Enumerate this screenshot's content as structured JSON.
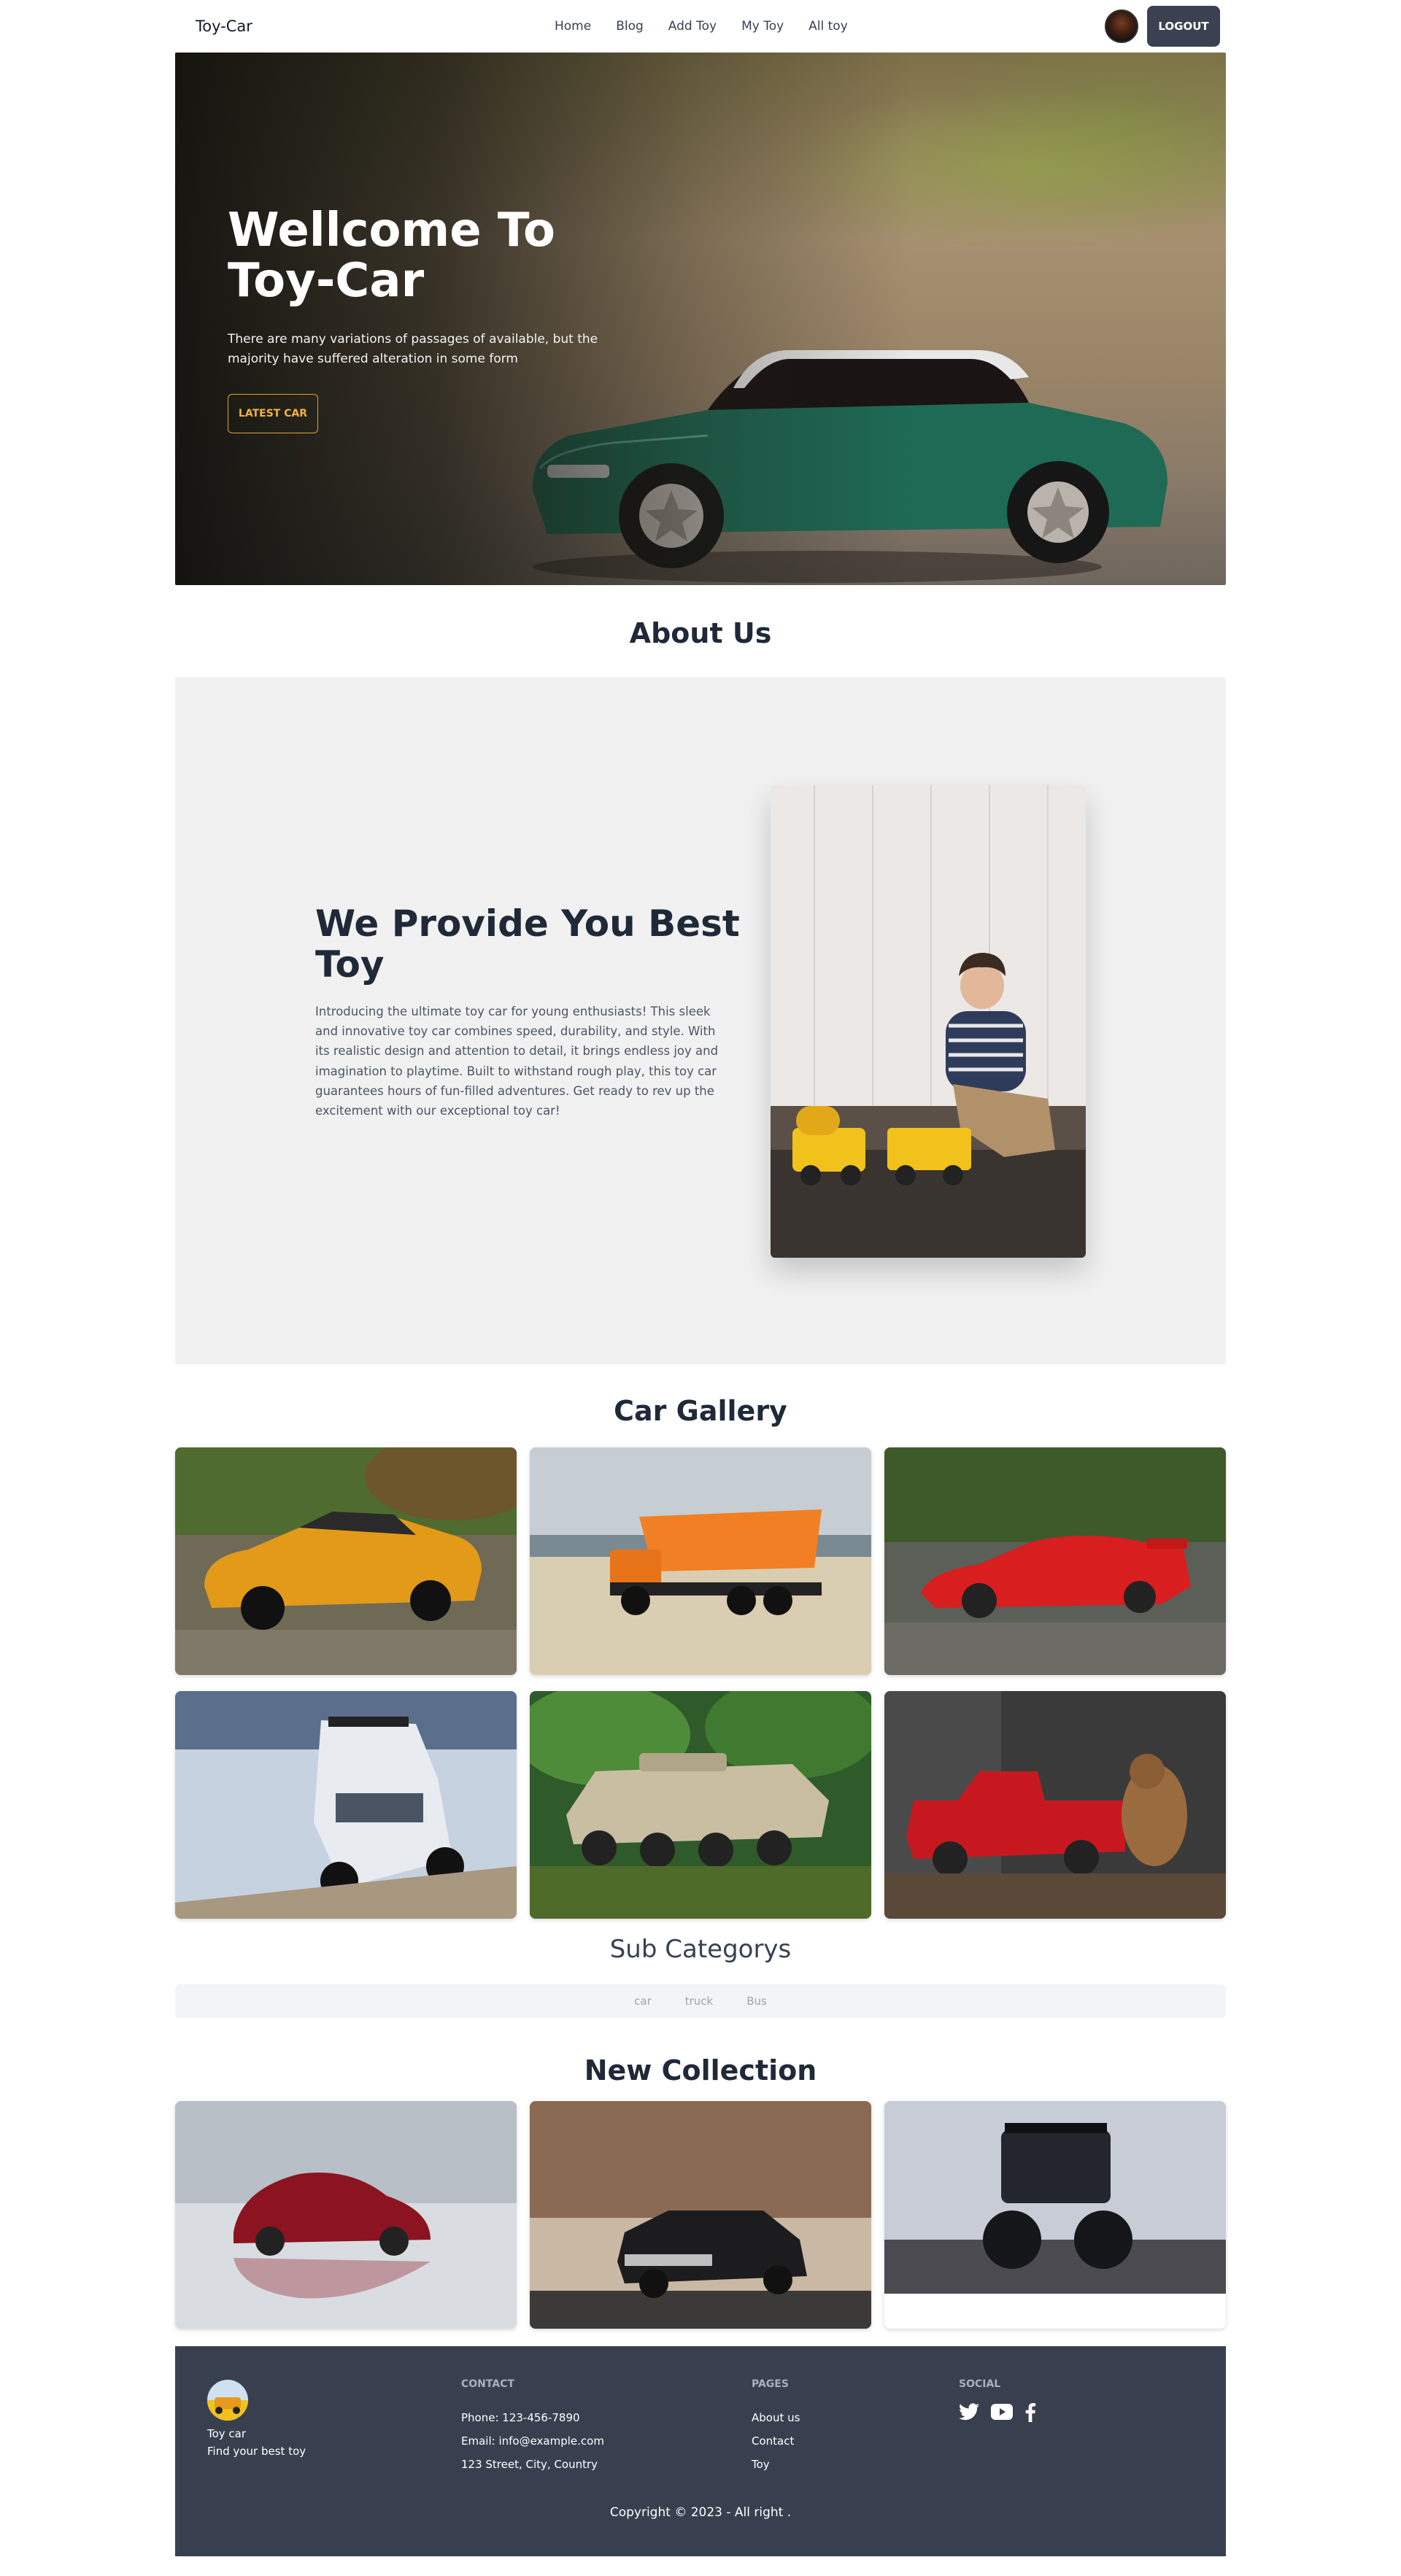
{
  "nav": {
    "brand": "Toy-Car",
    "links": [
      "Home",
      "Blog",
      "Add Toy",
      "My Toy",
      "All toy"
    ],
    "logout": "LOGOUT"
  },
  "hero": {
    "title_line1": "Wellcome To",
    "title_line2": "Toy-Car",
    "text": "There are many variations of passages of available, but the majority have suffered alteration in some form",
    "button": "LATEST CAR"
  },
  "about": {
    "section_title": "About Us",
    "heading": "We Provide You Best Toy",
    "text": "Introducing the ultimate toy car for young enthusiasts! This sleek and innovative toy car combines speed, durability, and style. With its realistic design and attention to detail, it brings endless joy and imagination to playtime. Built to withstand rough play, this toy car guarantees hours of fun-filled adventures. Get ready to rev up the excitement with our exceptional toy car!"
  },
  "gallery": {
    "title": "Car Gallery"
  },
  "subcategories": {
    "title": "Sub Categorys",
    "tabs": [
      "car",
      "truck",
      "Bus"
    ]
  },
  "collection": {
    "title": "New Collection"
  },
  "footer": {
    "brand_name": "Toy car",
    "brand_tagline": "Find your best toy",
    "contact_title": "CONTACT",
    "phone": "Phone: 123-456-7890",
    "email": "Email: info@example.com",
    "address": "123 Street, City, Country",
    "pages_title": "PAGES",
    "pages": [
      "About us",
      "Contact",
      "Toy"
    ],
    "social_title": "SOCIAL",
    "social_icons": [
      "twitter-icon",
      "youtube-icon",
      "facebook-icon"
    ],
    "copyright": "Copyright © 2023 - All right ."
  },
  "colors": {
    "button_dark": "#3b4150",
    "hero_accent": "#e0a32a",
    "footer_bg": "#384050",
    "about_bg": "#f1f1f2"
  }
}
